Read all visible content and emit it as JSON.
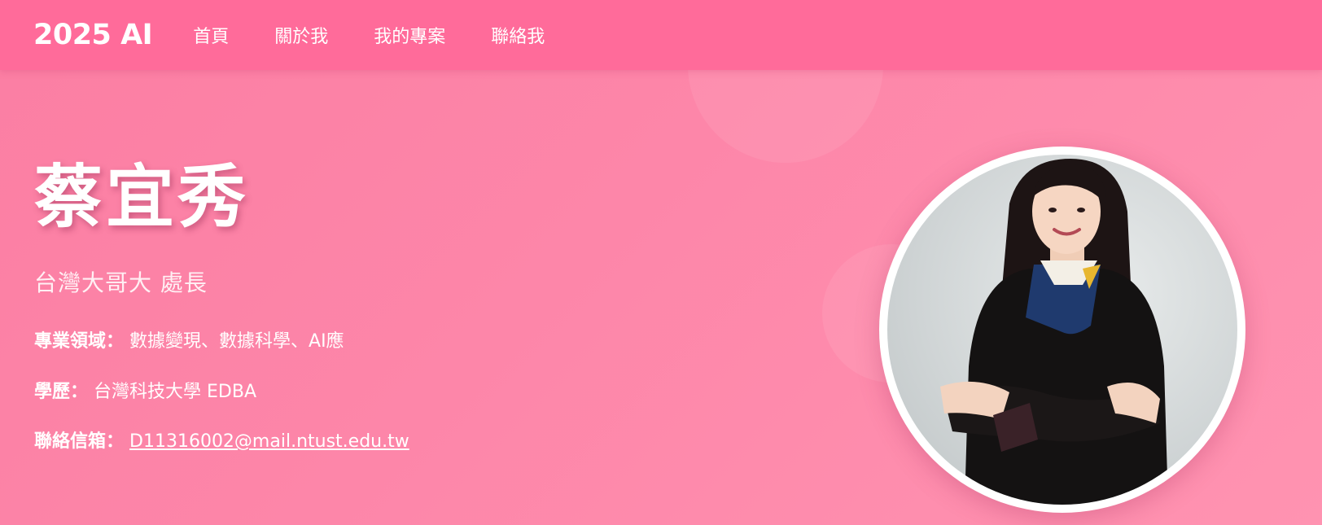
{
  "nav": {
    "brand": "2025 AI",
    "links": [
      "首頁",
      "關於我",
      "我的專案",
      "聯絡我"
    ]
  },
  "hero": {
    "name": "蔡宜秀",
    "title": "台灣大哥大 處長",
    "info": [
      {
        "label": "專業領域：",
        "value": "數據變現、數據科學、AI應"
      },
      {
        "label": "學歷：",
        "value": "台灣科技大學 EDBA"
      },
      {
        "label": "聯絡信箱：",
        "value": "D11316002@mail.ntust.edu.tw"
      }
    ]
  },
  "profile_photo": {
    "subject": "professional portrait of woman in black blazer with blue and yellow scarf, arms crossed"
  },
  "colors": {
    "navbar": "#ff6b9a",
    "background": "#fd86a9",
    "text": "#ffffff"
  }
}
